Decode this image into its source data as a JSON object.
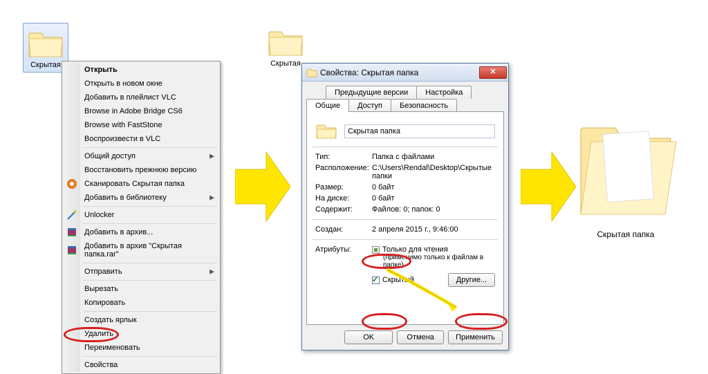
{
  "folders": {
    "left": {
      "label": "Скрытая"
    },
    "middle": {
      "label": "Скрытая"
    },
    "right": {
      "label": "Скрытая папка"
    }
  },
  "context_menu": {
    "items": [
      {
        "label": "Открыть",
        "bold": true
      },
      {
        "label": "Открыть в новом окне"
      },
      {
        "label": "Добавить в плейлист VLC"
      },
      {
        "label": "Browse in Adobe Bridge CS6"
      },
      {
        "label": "Browse with FastStone"
      },
      {
        "label": "Воспроизвести в VLC"
      }
    ],
    "items2": [
      {
        "label": "Общий доступ",
        "sub": true
      },
      {
        "label": "Восстановить прежнюю версию"
      },
      {
        "label": "Сканировать Скрытая папка",
        "icon": "scan-icon"
      },
      {
        "label": "Добавить в библиотеку",
        "sub": true
      }
    ],
    "items3": [
      {
        "label": "Unlocker",
        "icon": "unlocker-icon"
      }
    ],
    "items4": [
      {
        "label": "Добавить в архив...",
        "icon": "rar-icon"
      },
      {
        "label": "Добавить в архив \"Скрытая папка.rar\"",
        "icon": "rar-icon"
      }
    ],
    "items5": [
      {
        "label": "Отправить",
        "sub": true
      }
    ],
    "items6": [
      {
        "label": "Вырезать"
      },
      {
        "label": "Копировать"
      }
    ],
    "items7": [
      {
        "label": "Создать ярлык"
      },
      {
        "label": "Удалить"
      },
      {
        "label": "Переименовать"
      }
    ],
    "items8": [
      {
        "label": "Свойства"
      }
    ]
  },
  "dialog": {
    "title": "Свойства: Скрытая папка",
    "tabs_row1": [
      "Предыдущие версии",
      "Настройка"
    ],
    "tabs_row2": [
      "Общие",
      "Доступ",
      "Безопасность"
    ],
    "name_value": "Скрытая папка",
    "fields": {
      "type_label": "Тип:",
      "type_value": "Папка с файлами",
      "location_label": "Расположение:",
      "location_value": "C:\\Users\\Rendal\\Desktop\\Скрытые папки",
      "size_label": "Размер:",
      "size_value": "0 байт",
      "disk_label": "На диске:",
      "disk_value": "0 байт",
      "contains_label": "Содержит:",
      "contains_value": "Файлов: 0; папок: 0",
      "created_label": "Создан:",
      "created_value": "2 апреля 2015 г., 9:46:00",
      "attr_label": "Атрибуты:",
      "readonly_label": "Только для чтения",
      "readonly_sub": "(применимо только к файлам в папке)",
      "hidden_label": "Скрытый",
      "other_btn": "Другие..."
    },
    "buttons": {
      "ok": "OK",
      "cancel": "Отмена",
      "apply": "Применить"
    }
  }
}
